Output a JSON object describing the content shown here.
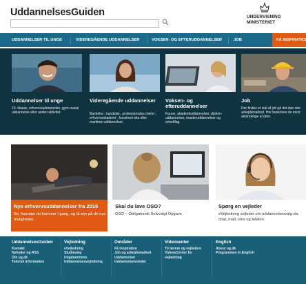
{
  "header": {
    "logo": "UddannelsesGuiden",
    "search_placeholder": "",
    "ministry_line1": "UNDERVISNING",
    "ministry_line2": "MINISTERIET"
  },
  "nav": {
    "items": [
      {
        "label": "UDDANNELSER TIL UNGE"
      },
      {
        "label": "VIDEREGÅENDE UDDANNELSER"
      },
      {
        "label": "VOKSEN- OG EFTERUDDANNELSER"
      },
      {
        "label": "JOB"
      },
      {
        "label": "FÅ INSPIRATION"
      }
    ]
  },
  "tiles": [
    {
      "title": "Uddannelser til unge",
      "desc": "10. klasse, erhvervsuddannelse, gym-nasial uddannelse eller anden aktivitet."
    },
    {
      "title": "Videregående uddannelser",
      "desc": "Bachelor-, kandidat-, professionsba-chelor-, erhvervsakademi-, kunstneri-ske eller maritime uddannelser."
    },
    {
      "title": "Voksen- og efteruddannelser",
      "desc": "Kurser, akademiuddannelser, diplom-uddannelser, masteruddannelser og enkeltfag."
    },
    {
      "title": "Job",
      "desc": "Der findes et stal af job på det dan-ske arbejdsmarked. Her beskrives de mest almindelige af dem."
    }
  ],
  "cards": [
    {
      "title": "Nye erhvervsuddannelser fra 2015",
      "desc": "Se, hvordan du kommer i gang, og få styr på de nye muligheder."
    },
    {
      "title": "Skal du lave OSO?",
      "desc": "OSO – Obligatorisk Selvvalgt Opgave."
    },
    {
      "title": "Spørg en vejleder",
      "desc": "eVejledning vejleder om uddannelsesvalg via chat, mail, sms og telefon."
    }
  ],
  "footer": {
    "columns": [
      {
        "head": "UddannelsesGuiden",
        "links": [
          "Kontakt",
          "Nyheder og RSS",
          "Om ug.dk",
          "Teknisk information"
        ]
      },
      {
        "head": "Vejledning",
        "links": [
          "eVejledning",
          "Studievalg",
          "Ungdommens",
          "Uddannelsesvejledning"
        ]
      },
      {
        "head": "Områder",
        "links": [
          "Få inspiration",
          "Job og arbejdsmarked",
          "Uddannelser",
          "Uddannelsessteder"
        ]
      },
      {
        "head": "Vidensenter",
        "links": [
          "Til lærere og vejledere",
          "VidensCenter for",
          "vejledning"
        ]
      },
      {
        "head": "English",
        "links": [
          "About ug.dk",
          "Programmes in English"
        ]
      }
    ]
  },
  "colors": {
    "nav": "#1c6a8a",
    "accent": "#e15a14",
    "band": "#10343f",
    "footer": "#1a5f78"
  },
  "icons": {
    "search": "search-icon",
    "crown": "crown-icon"
  }
}
